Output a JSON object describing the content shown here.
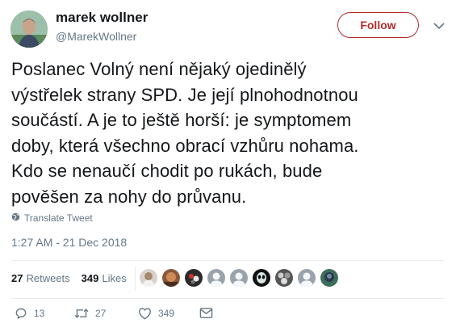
{
  "author": {
    "name": "marek wollner",
    "handle": "@MarekWollner"
  },
  "follow_label": "Follow",
  "tweet": {
    "text": "Poslanec Volný není nějaký ojedinělý\nvýstřelek strany SPD. Je její plnohodnotnou\nsoučástí. A je to ještě horší: je symptomem\ndoby, která všechno obrací vzhůru nohama.\nKdo se nenaučí chodit po rukách, bude\npověšen za nohy do průvanu.",
    "translate_label": "Translate Tweet",
    "timestamp": "1:27 AM - 21 Dec 2018"
  },
  "stats": {
    "retweets_count": "27",
    "retweets_label": "Retweets",
    "likes_count": "349",
    "likes_label": "Likes"
  },
  "actions": {
    "reply_count": "13",
    "retweet_count": "27",
    "like_count": "349"
  },
  "colors": {
    "follow_accent": "#b32b2b",
    "muted_text": "#657786"
  },
  "icons": [
    "chevron-down-icon",
    "globe-icon",
    "reply-icon",
    "retweet-icon",
    "heart-icon",
    "message-icon"
  ]
}
